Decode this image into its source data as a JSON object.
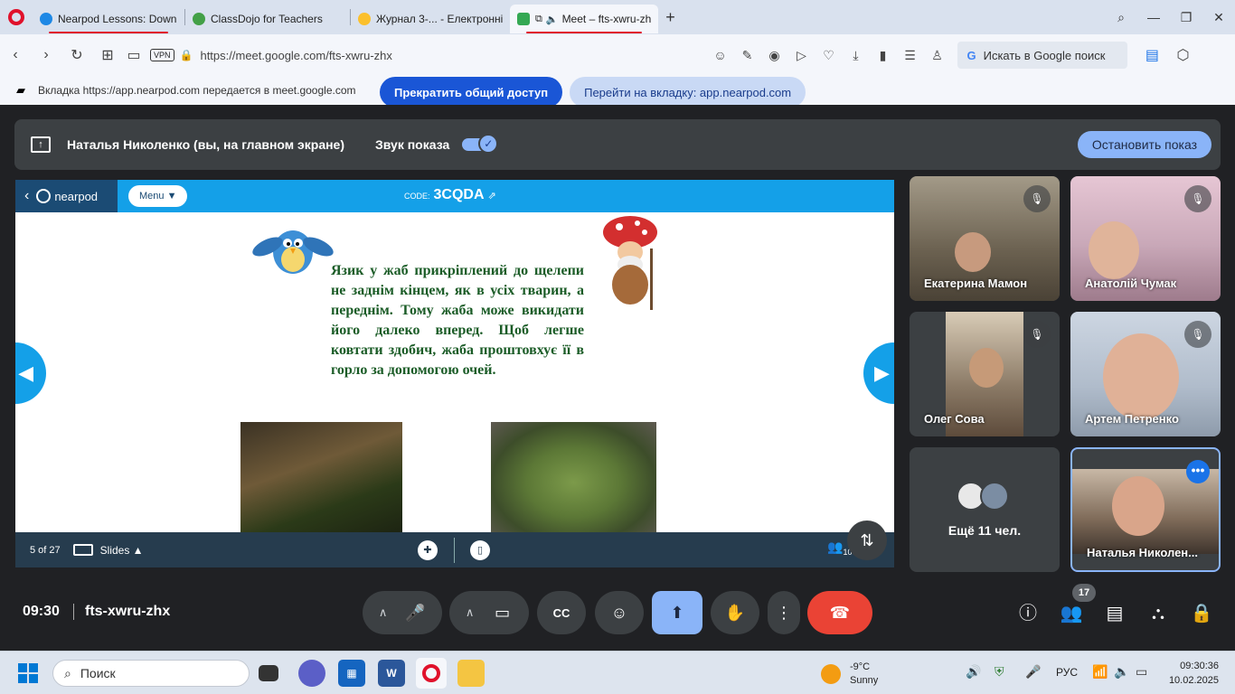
{
  "browser": {
    "tabs": [
      {
        "title": "Nearpod Lessons: Downlo",
        "favicon_color": "#1e88e5"
      },
      {
        "title": "ClassDojo for Teachers",
        "favicon_color": "#43a047"
      },
      {
        "title": "Журнал 3-... - Електронні",
        "favicon_color": "#fbc02d"
      },
      {
        "title": "Meet – fts-xwru-zh",
        "favicon_color": "#34a853"
      }
    ],
    "new_tab": "+",
    "url": "https://meet.google.com/fts-xwru-zhx",
    "vpn_badge": "VPN",
    "search_placeholder": "Искать в Google поиск",
    "search_g": "G"
  },
  "share_bar": {
    "message": "Вкладка https://app.nearpod.com передается в meet.google.com",
    "stop_sharing": "Прекратить общий доступ",
    "goto_tab": "Перейти на вкладку: app.nearpod.com"
  },
  "present_bar": {
    "presenter": "Наталья Николенко (вы, на главном экране)",
    "sound_label": "Звук показа",
    "sound_on": true,
    "stop_button": "Остановить показ"
  },
  "nearpod": {
    "brand": "nearpod",
    "menu": "Menu ▼",
    "code_label": "CODE:",
    "code": "3CQDA",
    "slide_text": "Язик у жаб прикріплений до щелепи не заднім кінцем, як в усіх тварин, а переднім. Тому жаба може викидати його далеко вперед. Щоб легше ковтати здобич, жаба проштовхує її в горло за допомогою очей.",
    "page": "5 of 27",
    "slides_label": "Slides ▲",
    "people_count": "10"
  },
  "participants": [
    {
      "name": "Екатерина Мамон",
      "muted": true,
      "bg": "#6b6150"
    },
    {
      "name": "Анатолій Чумак",
      "muted": true,
      "bg": "#c9a8b8"
    },
    {
      "name": "Олег Сова",
      "muted": true,
      "bg": "#8b7a66"
    },
    {
      "name": "Артем Петренко",
      "muted": true,
      "bg": "#b0bccb"
    }
  ],
  "others_tile": {
    "label": "Ещё 11 чел."
  },
  "self_tile": {
    "name": "Наталья Николен..."
  },
  "meet_bar": {
    "time": "09:30",
    "meeting_code": "fts-xwru-zhx",
    "participants_badge": "17"
  },
  "taskbar": {
    "search": "Поиск",
    "weather_temp": "-9°C",
    "weather_desc": "Sunny",
    "lang": "РУС",
    "time": "09:30:36",
    "date": "10.02.2025"
  },
  "colors": {
    "meet_bg": "#202124",
    "accent": "#8ab4f8",
    "leave": "#ea4335",
    "nearpod_blue": "#14a0e8"
  }
}
